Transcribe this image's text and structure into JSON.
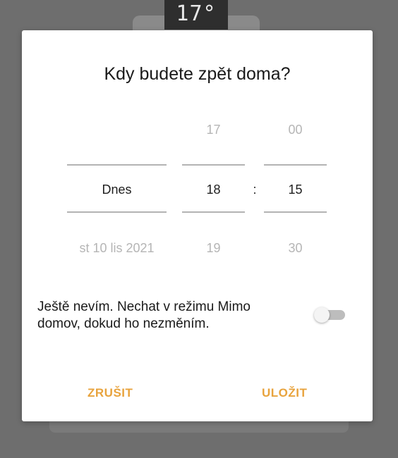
{
  "background": {
    "temperature_display": "17°"
  },
  "dialog": {
    "title": "Kdy budete zpět doma?",
    "picker": {
      "day": {
        "above": "",
        "selected": "Dnes",
        "below": "st 10 lis 2021"
      },
      "hour": {
        "above": "17",
        "selected": "18",
        "below": "19"
      },
      "separator": ":",
      "minute": {
        "above": "00",
        "selected": "15",
        "below": "30"
      }
    },
    "away_option": {
      "label": "Ještě nevím. Nechat v režimu Mimo domov, dokud ho nezměním.",
      "enabled": false
    },
    "actions": {
      "cancel_label": "ZRUŠIT",
      "save_label": "ULOŽIT"
    }
  },
  "colors": {
    "accent": "#e8a33d",
    "selected_text": "#1f1f1f",
    "dim_text": "#b5b5b5",
    "divider": "#b3b3b3",
    "scrim": "#6e6e6e"
  }
}
